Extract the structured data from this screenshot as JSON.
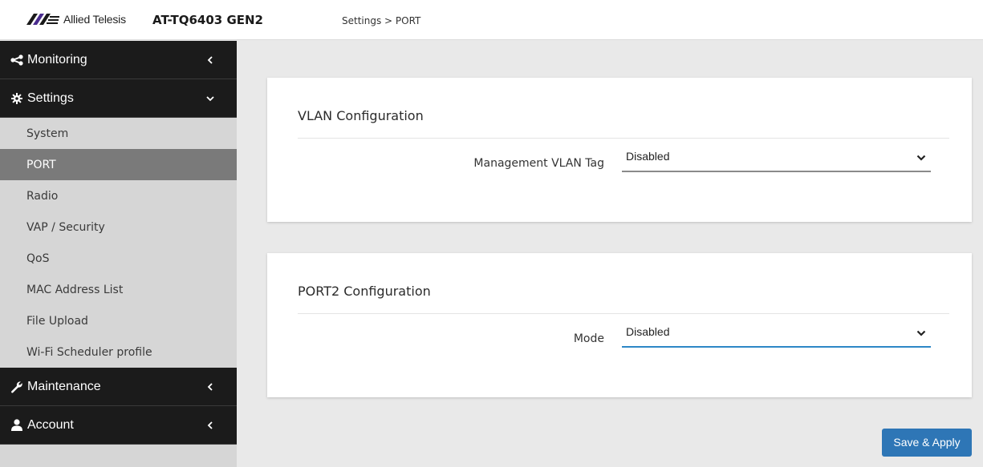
{
  "header": {
    "brand": "Allied Telesis",
    "model": "AT-TQ6403 GEN2",
    "breadcrumb": "Settings > PORT"
  },
  "sidebar": {
    "sections": [
      {
        "label": "Monitoring",
        "icon": "share-icon",
        "state": "collapsed"
      },
      {
        "label": "Settings",
        "icon": "gear-icon",
        "state": "expanded"
      },
      {
        "label": "Maintenance",
        "icon": "wrench-icon",
        "state": "collapsed"
      },
      {
        "label": "Account",
        "icon": "user-icon",
        "state": "collapsed"
      }
    ],
    "settings_items": [
      {
        "label": "System"
      },
      {
        "label": "PORT",
        "active": true
      },
      {
        "label": "Radio"
      },
      {
        "label": "VAP / Security"
      },
      {
        "label": "QoS"
      },
      {
        "label": "MAC Address List"
      },
      {
        "label": "File Upload"
      },
      {
        "label": "Wi-Fi Scheduler profile"
      }
    ]
  },
  "vlan": {
    "title": "VLAN Configuration",
    "field_label": "Management VLAN Tag",
    "value": "Disabled"
  },
  "port2": {
    "title": "PORT2 Configuration",
    "field_label": "Mode",
    "value": "Disabled"
  },
  "actions": {
    "save_label": "Save & Apply"
  },
  "colors": {
    "accent": "#2e76b6",
    "focus_underline": "#2d87c6",
    "sidebar_dark": "#1b1b1b",
    "sidebar_active": "#7a7a7a",
    "logo_purple": "#4a2c8f"
  }
}
